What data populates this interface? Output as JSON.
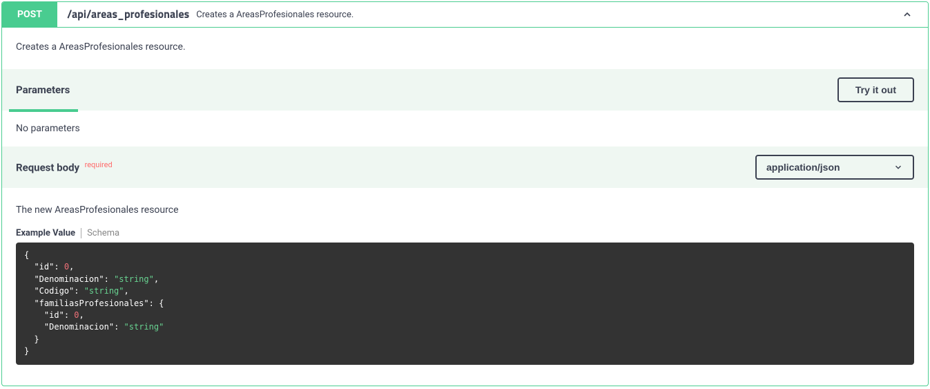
{
  "header": {
    "method": "POST",
    "path": "/api/areas_profesionales",
    "summary": "Creates a AreasProfesionales resource."
  },
  "description": "Creates a AreasProfesionales resource.",
  "parameters": {
    "title": "Parameters",
    "empty": "No parameters",
    "tryItOut": "Try it out"
  },
  "requestBody": {
    "title": "Request body",
    "requiredLabel": "required",
    "contentType": "application/json",
    "description": "The new AreasProfesionales resource",
    "tabs": {
      "exampleValue": "Example Value",
      "schema": "Schema"
    },
    "example": {
      "id": 0,
      "Denominacion": "string",
      "Codigo": "string",
      "familiasProfesionales": {
        "id": 0,
        "Denominacion": "string"
      }
    }
  }
}
